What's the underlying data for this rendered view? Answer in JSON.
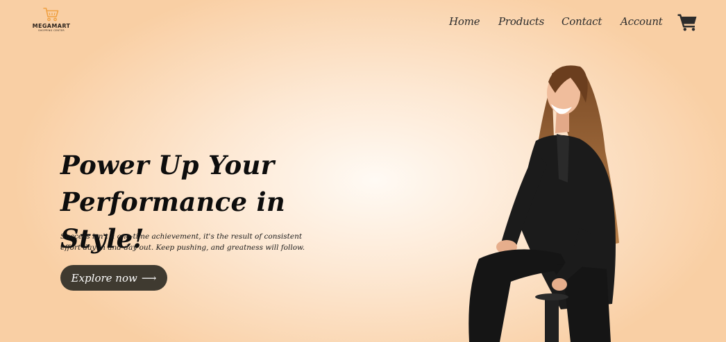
{
  "brand": {
    "name": "MEGAMART",
    "tagline": "SHOPPING CENTER",
    "accent_color": "#f0a040",
    "icon": "shopping-cart-icon"
  },
  "nav": {
    "items": [
      {
        "label": "Home"
      },
      {
        "label": "Products"
      },
      {
        "label": "Contact"
      },
      {
        "label": "Account"
      }
    ],
    "cart_icon": "shopping-cart-icon"
  },
  "hero": {
    "title_line1": "Power Up Your",
    "title_line2": "Performance in Style!",
    "description": "Success isn't a one-time achievement, it's the result of consistent effort day in and day out. Keep pushing, and greatness will follow.",
    "cta_label": "Explore now",
    "cta_arrow": "⟶",
    "cta_color": "#3f3a30",
    "image": "woman-in-black-suit-sitting-on-stool"
  }
}
